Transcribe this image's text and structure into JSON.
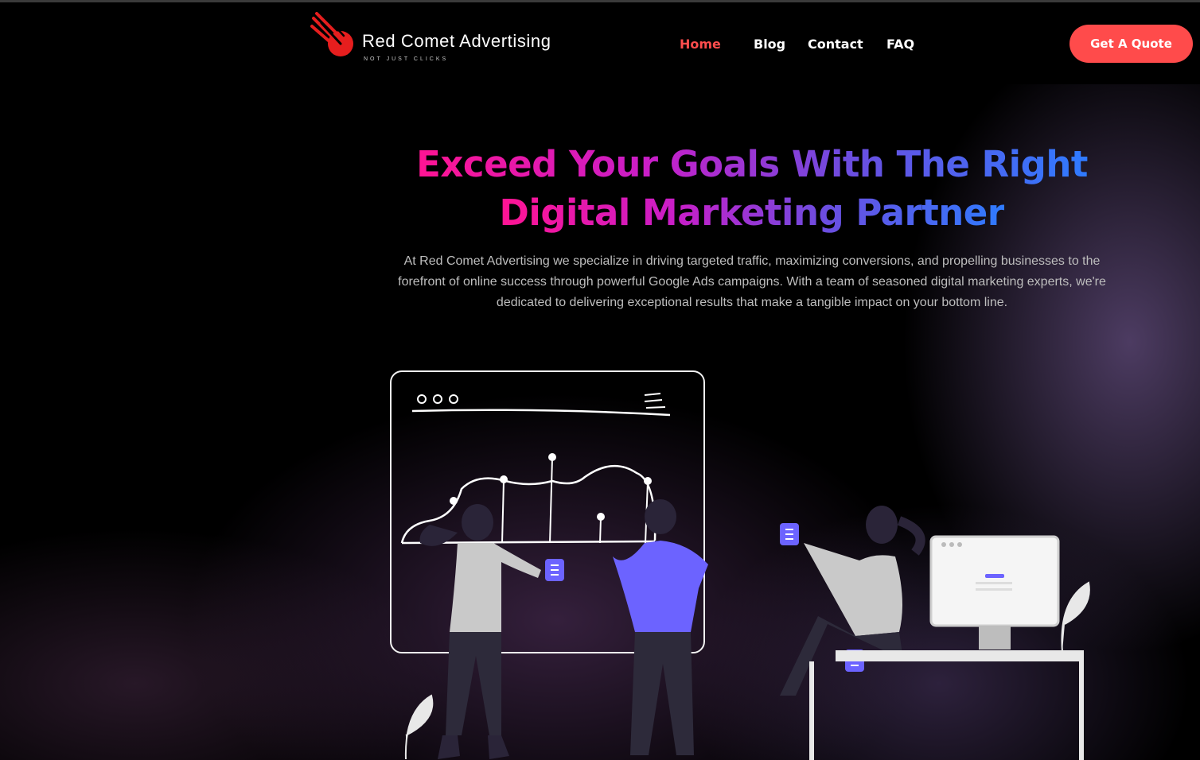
{
  "brand": {
    "name": "Red Comet Advertising",
    "tagline": "NOT JUST CLICKS"
  },
  "nav": {
    "links": [
      {
        "label": "Home",
        "active": true
      },
      {
        "label": "Blog",
        "active": false
      },
      {
        "label": "Contact",
        "active": false
      },
      {
        "label": "FAQ",
        "active": false
      }
    ],
    "cta_label": "Get A Quote"
  },
  "hero": {
    "headline_line1": "Exceed Your Goals With The Right",
    "headline_line2": "Digital Marketing Partner",
    "intro": "At Red Comet Advertising we specialize in driving targeted traffic, maximizing conversions, and propelling businesses to the forefront of online success through powerful Google Ads campaigns. With a team of seasoned digital marketing experts, we're dedicated to delivering exceptional results that make a tangible impact on your bottom line."
  },
  "colors": {
    "accent": "#ff4b4b",
    "background": "#000000",
    "gradient_start": "#ff1493",
    "gradient_end": "#2f7bff",
    "illustration_purple": "#6c63ff"
  },
  "icons": [
    "comet-logo-icon",
    "browser-dots-icon",
    "document-icon",
    "leaf-icon"
  ]
}
